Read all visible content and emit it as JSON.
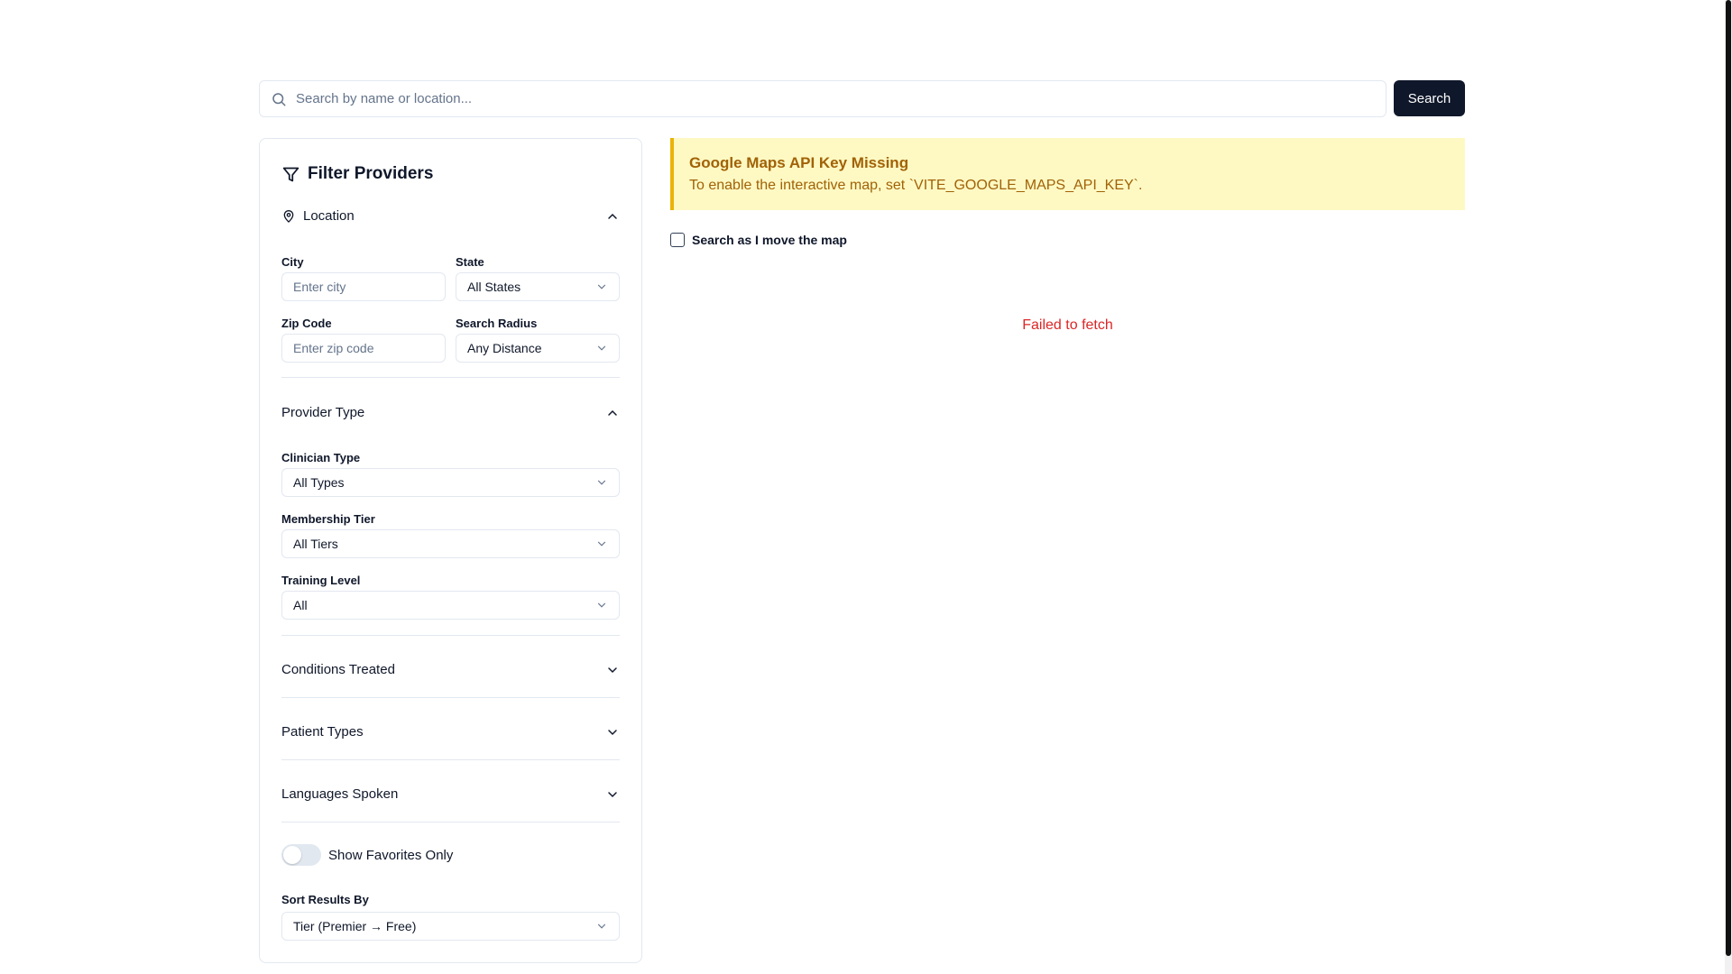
{
  "search": {
    "placeholder": "Search by name or location...",
    "button_label": "Search"
  },
  "filters": {
    "title": "Filter Providers",
    "location": {
      "label": "Location",
      "city_label": "City",
      "city_placeholder": "Enter city",
      "state_label": "State",
      "state_value": "All States",
      "zip_label": "Zip Code",
      "zip_placeholder": "Enter zip code",
      "radius_label": "Search Radius",
      "radius_value": "Any Distance"
    },
    "provider_type": {
      "label": "Provider Type",
      "clinician_label": "Clinician Type",
      "clinician_value": "All Types",
      "tier_label": "Membership Tier",
      "tier_value": "All Tiers",
      "training_label": "Training Level",
      "training_value": "All"
    },
    "conditions_label": "Conditions Treated",
    "patient_types_label": "Patient Types",
    "languages_label": "Languages Spoken",
    "favorites_label": "Show Favorites Only",
    "favorites_on": false,
    "sort_label": "Sort Results By",
    "sort_value": "Tier (Premier → Free)"
  },
  "alert": {
    "title": "Google Maps API Key Missing",
    "text": "To enable the interactive map, set `VITE_GOOGLE_MAPS_API_KEY`."
  },
  "map": {
    "search_as_move_label": "Search as I move the map",
    "checked": false
  },
  "error": "Failed to fetch",
  "colors": {
    "primary_button": "#0f172a",
    "alert_bg": "#fef9c3",
    "alert_border": "#eab308",
    "alert_text": "#a16207",
    "error": "#dc2626"
  }
}
